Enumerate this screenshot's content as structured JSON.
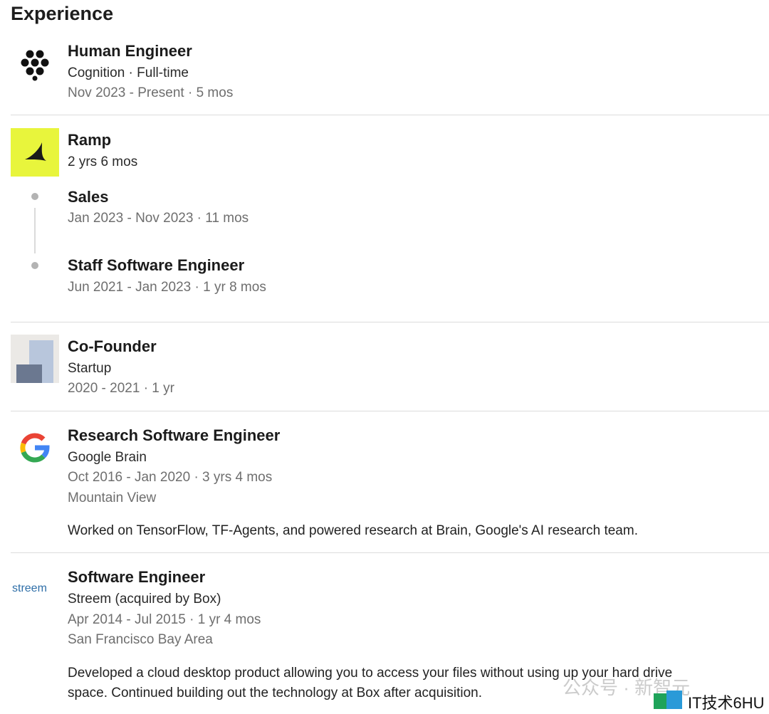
{
  "section": {
    "title": "Experience"
  },
  "jobs": [
    {
      "title": "Human Engineer",
      "subtitle": "Cognition · Full-time",
      "dates": "Nov 2023 - Present · 5 mos",
      "logo": "cognition-logo"
    },
    {
      "company": "Ramp",
      "duration": "2 yrs 6 mos",
      "logo": "ramp-logo",
      "roles": [
        {
          "title": "Sales",
          "dates": "Jan 2023 - Nov 2023 · 11 mos"
        },
        {
          "title": "Staff Software Engineer",
          "dates": "Jun 2021 - Jan 2023 · 1 yr 8 mos"
        }
      ]
    },
    {
      "title": "Co-Founder",
      "subtitle": "Startup",
      "dates": "2020 - 2021 · 1 yr",
      "logo": "startup-logo"
    },
    {
      "title": "Research Software Engineer",
      "subtitle": "Google Brain",
      "dates": "Oct 2016 - Jan 2020 · 3 yrs 4 mos",
      "location": "Mountain View",
      "description": "Worked on TensorFlow, TF-Agents, and powered research at Brain, Google's AI research team.",
      "logo": "google-logo"
    },
    {
      "title": "Software Engineer",
      "subtitle": "Streem (acquired by Box)",
      "dates": "Apr 2014 - Jul 2015 · 1 yr 4 mos",
      "location": "San Francisco Bay Area",
      "description_line1": "Developed a cloud desktop product allowing you to access your files without using up your hard drive",
      "description_line2": "space. Continued building out the technology at Box after acquisition.",
      "logo": "streem-logo",
      "logo_text": "streem"
    }
  ],
  "watermark": {
    "line1": "公众号 · 新智元",
    "line2": "IT技术6HU"
  },
  "colors": {
    "ramp_bg": "#e8f53c",
    "divider": "#dcdcdc",
    "muted_text": "#6e6e6e"
  }
}
